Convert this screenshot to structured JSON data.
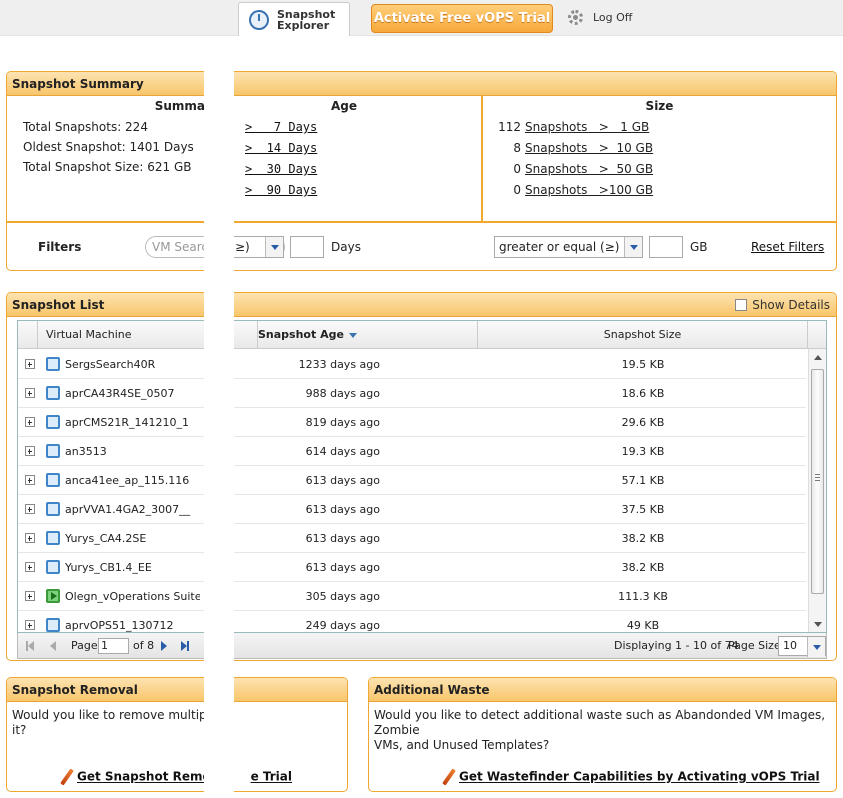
{
  "header": {
    "tab_label": "Snapshot Explorer",
    "trial_button": "Activate Free vOPS Trial",
    "logoff_label": "Log Off"
  },
  "summary": {
    "title": "Snapshot Summary",
    "col_summary": "Summa",
    "col_age": "Age",
    "col_size": "Size",
    "lines": [
      "Total Snapshots: 224",
      "Oldest Snapshot: 1401 Days",
      "Total Snapshot Size: 621 GB"
    ],
    "age_links": [
      ">   7 Days",
      ">  14 Days",
      ">  30 Days",
      ">  90 Days"
    ],
    "size_rows": [
      {
        "count": "112",
        "label": "Snapshots   >   1 GB"
      },
      {
        "count": "8",
        "label": "Snapshots   >  10 GB"
      },
      {
        "count": "0",
        "label": "Snapshots   >  50 GB"
      },
      {
        "count": "0",
        "label": "Snapshots   >100 GB"
      }
    ]
  },
  "filters": {
    "label": "Filters",
    "search_placeholder": "VM Searc",
    "age_select": "≥)",
    "age_unit": "Days",
    "size_select": "greater or equal (≥)",
    "size_unit": "GB",
    "reset": "Reset Filters"
  },
  "list": {
    "title": "Snapshot List",
    "show_details": "Show Details",
    "columns": {
      "vm": "Virtual Machine",
      "age": "Snapshot Age",
      "size": "Snapshot Size"
    },
    "rows": [
      {
        "name": "SergsSearch40R",
        "age": "1233 days ago",
        "size": "19.5 KB",
        "on": false
      },
      {
        "name": "aprCA43R4SE_0507",
        "age": "988 days ago",
        "size": "18.6 KB",
        "on": false
      },
      {
        "name": "aprCMS21R_141210_1",
        "age": "819 days ago",
        "size": "29.6 KB",
        "on": false
      },
      {
        "name": "an3513",
        "age": "614 days ago",
        "size": "19.3 KB",
        "on": false
      },
      {
        "name": "anca41ee_ap_115.116",
        "age": "613 days ago",
        "size": "57.1 KB",
        "on": false
      },
      {
        "name": "aprVVA1.4GA2_3007__",
        "age": "613 days ago",
        "size": "37.5 KB",
        "on": false
      },
      {
        "name": "Yurys_CA4.2SE",
        "age": "613 days ago",
        "size": "38.2 KB",
        "on": false
      },
      {
        "name": "Yurys_CB1.4_EE",
        "age": "613 days ago",
        "size": "38.2 KB",
        "on": false
      },
      {
        "name": "Olegn_vOperations Suite_‹",
        "age": "305 days ago",
        "size": "111.3 KB",
        "on": true
      },
      {
        "name": "aprvOPS51_130712",
        "age": "249 days ago",
        "size": "49 KB",
        "on": false
      }
    ],
    "pager": {
      "page_label": "Page",
      "page_value": "1",
      "of_label": "of 8",
      "displaying": "Displaying 1 - 10 of 74",
      "page_size_label": "Page Size",
      "page_size_value": "10"
    }
  },
  "removal": {
    "title": "Snapshot Removal",
    "text1": "Would you like to remove multiple s",
    "text2": "it?",
    "link_a": "Get Snapshot Remov",
    "link_b": "e Trial"
  },
  "waste": {
    "title": "Additional Waste",
    "text1": "Would you like to detect additional waste such as Abandonded VM Images, Zombie",
    "text2": "VMs, and Unused Templates?",
    "link": "Get Wastefinder Capabilities by Activating vOPS Trial"
  }
}
